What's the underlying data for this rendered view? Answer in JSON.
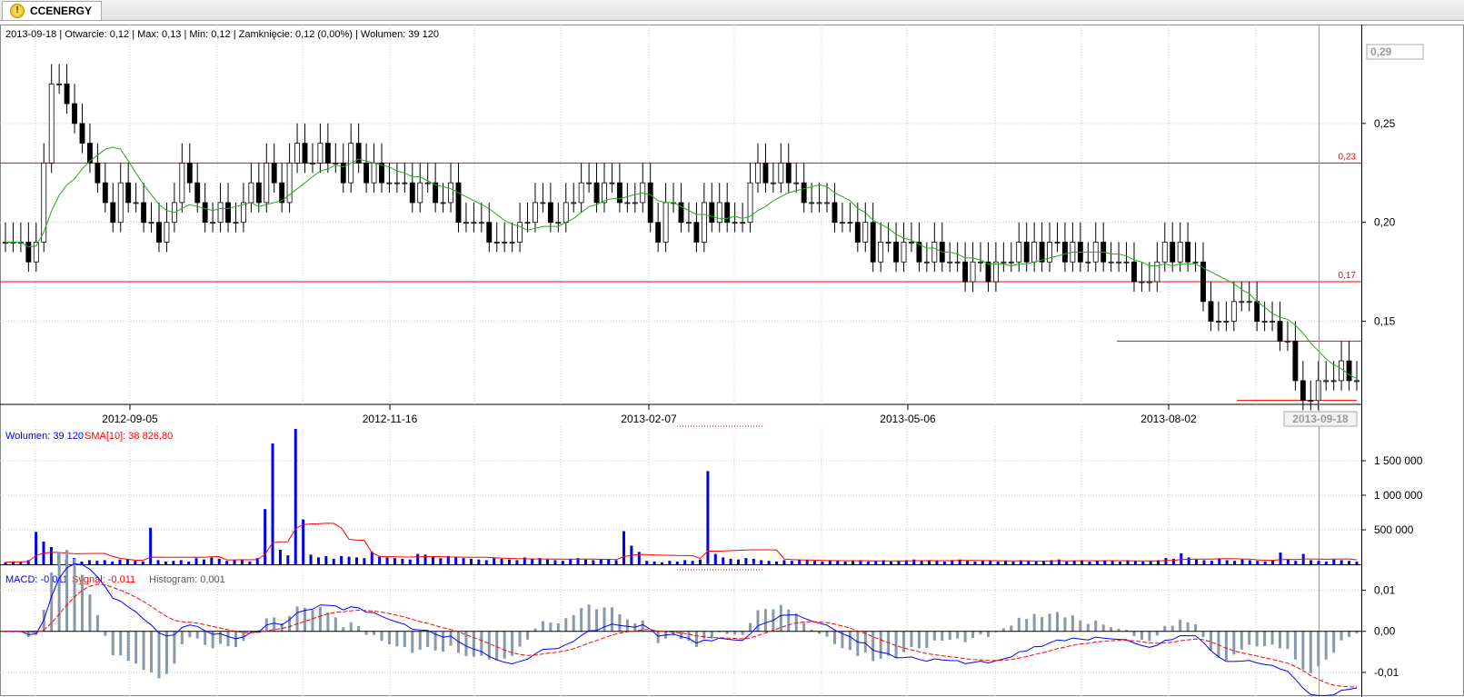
{
  "tab": {
    "title": "CCENERGY",
    "icon": "warning-icon"
  },
  "info_line": "2013-09-18 | Otwarcie: 0,12 | Max: 0,13 | Min: 0,12 | Zamknięcie: 0,12 (0,00%)  | Wolumen: 39 120",
  "volume_legend": {
    "volume_label": "Wolumen: 39 120",
    "sma_label": "SMA[10]: 38 826,80"
  },
  "macd_legend": {
    "macd_label": "MACD: -0,011",
    "signal_label": "Sygnał: -0,011",
    "hist_label": "Histogram: 0,001"
  },
  "colors": {
    "price": "#000000",
    "sma_price": "#22aa22",
    "level": "#ff0000",
    "volume": "#0000ee",
    "volume_sma": "#ff0000",
    "macd": "#0000ff",
    "signal": "#ff0000",
    "histogram": "#8899aa",
    "grid": "#c8c8c8"
  },
  "chart_data": [
    {
      "type": "candlestick",
      "x_tick_labels": [
        "2012-09-05",
        "2012-11-16",
        "2013-02-07",
        "2013-05-06",
        "2013-08-02"
      ],
      "current_x_label": "2013-09-18",
      "y_tick_labels": [
        "0,25",
        "0,20",
        "0,15"
      ],
      "current_value_label": "0,29",
      "ylim": [
        0.108,
        0.3
      ],
      "grid": true,
      "levels": [
        {
          "value": 0.23,
          "label": "0,23"
        },
        {
          "value": 0.17,
          "label": "0,17"
        },
        {
          "value": 0.14,
          "label": ""
        },
        {
          "value": 0.11,
          "label": ""
        }
      ],
      "close": [
        0.19,
        0.19,
        0.19,
        0.18,
        0.19,
        0.23,
        0.27,
        0.27,
        0.26,
        0.25,
        0.24,
        0.23,
        0.22,
        0.21,
        0.2,
        0.22,
        0.21,
        0.21,
        0.2,
        0.2,
        0.19,
        0.2,
        0.21,
        0.23,
        0.22,
        0.21,
        0.2,
        0.2,
        0.21,
        0.2,
        0.2,
        0.21,
        0.22,
        0.21,
        0.23,
        0.22,
        0.21,
        0.23,
        0.24,
        0.23,
        0.23,
        0.24,
        0.23,
        0.23,
        0.22,
        0.24,
        0.23,
        0.22,
        0.23,
        0.22,
        0.22,
        0.22,
        0.22,
        0.21,
        0.22,
        0.22,
        0.21,
        0.21,
        0.22,
        0.2,
        0.2,
        0.2,
        0.2,
        0.19,
        0.19,
        0.19,
        0.19,
        0.2,
        0.2,
        0.21,
        0.21,
        0.2,
        0.2,
        0.21,
        0.21,
        0.22,
        0.22,
        0.21,
        0.22,
        0.22,
        0.21,
        0.21,
        0.21,
        0.22,
        0.2,
        0.19,
        0.21,
        0.21,
        0.2,
        0.2,
        0.19,
        0.21,
        0.2,
        0.21,
        0.2,
        0.2,
        0.2,
        0.22,
        0.23,
        0.22,
        0.22,
        0.23,
        0.22,
        0.22,
        0.21,
        0.21,
        0.21,
        0.21,
        0.2,
        0.2,
        0.2,
        0.19,
        0.2,
        0.18,
        0.19,
        0.19,
        0.18,
        0.19,
        0.19,
        0.18,
        0.18,
        0.19,
        0.18,
        0.18,
        0.18,
        0.17,
        0.18,
        0.18,
        0.17,
        0.18,
        0.18,
        0.18,
        0.19,
        0.18,
        0.19,
        0.18,
        0.19,
        0.19,
        0.18,
        0.19,
        0.18,
        0.18,
        0.19,
        0.18,
        0.18,
        0.18,
        0.18,
        0.17,
        0.17,
        0.17,
        0.18,
        0.19,
        0.18,
        0.19,
        0.18,
        0.18,
        0.16,
        0.15,
        0.15,
        0.15,
        0.16,
        0.16,
        0.16,
        0.15,
        0.15,
        0.15,
        0.14,
        0.14,
        0.12,
        0.11,
        0.11,
        0.12,
        0.12,
        0.12,
        0.13,
        0.12,
        0.12
      ],
      "sma_period": 10
    },
    {
      "type": "bar",
      "name": "Wolumen",
      "y_tick_labels": [
        "1 500 000",
        "1 000 000",
        "500 000"
      ],
      "ylim": [
        0,
        2000000
      ],
      "values": [
        30000,
        40000,
        35000,
        60000,
        470000,
        330000,
        250000,
        160000,
        70000,
        90000,
        40000,
        60000,
        50000,
        60000,
        40000,
        70000,
        80000,
        50000,
        40000,
        530000,
        60000,
        40000,
        50000,
        60000,
        40000,
        90000,
        70000,
        100000,
        80000,
        50000,
        60000,
        70000,
        40000,
        90000,
        800000,
        1750000,
        210000,
        130000,
        1960000,
        650000,
        140000,
        100000,
        120000,
        80000,
        120000,
        110000,
        100000,
        90000,
        180000,
        110000,
        100000,
        90000,
        80000,
        70000,
        150000,
        140000,
        110000,
        90000,
        120000,
        100000,
        90000,
        80000,
        70000,
        60000,
        90000,
        80000,
        70000,
        60000,
        100000,
        80000,
        90000,
        70000,
        60000,
        50000,
        80000,
        90000,
        70000,
        60000,
        80000,
        70000,
        60000,
        480000,
        270000,
        180000,
        50000,
        40000,
        30000,
        50000,
        40000,
        60000,
        50000,
        70000,
        1350000,
        150000,
        100000,
        80000,
        70000,
        90000,
        80000,
        60000,
        50000,
        40000,
        60000,
        50000,
        70000,
        60000,
        50000,
        40000,
        60000,
        50000,
        40000,
        50000,
        60000,
        40000,
        50000,
        60000,
        40000,
        50000,
        60000,
        70000,
        50000,
        60000,
        50000,
        40000,
        60000,
        70000,
        50000,
        40000,
        50000,
        60000,
        40000,
        50000,
        40000,
        60000,
        50000,
        40000,
        50000,
        60000,
        70000,
        40000,
        50000,
        60000,
        40000,
        50000,
        60000,
        50000,
        40000,
        60000,
        50000,
        40000,
        50000,
        60000,
        90000,
        80000,
        160000,
        100000,
        70000,
        60000,
        50000,
        80000,
        60000,
        50000,
        70000,
        60000,
        50000,
        40000,
        60000,
        170000,
        70000,
        50000,
        150000,
        60000,
        50000,
        40000,
        70000,
        60000,
        50000,
        39120
      ],
      "sma_name": "SMA[10]",
      "sma_period": 10
    },
    {
      "type": "line",
      "name": "MACD",
      "y_tick_labels": [
        "0,01",
        "0,00",
        "-0,01"
      ],
      "ylim": [
        -0.016,
        0.015
      ],
      "zero_line": true
    }
  ]
}
